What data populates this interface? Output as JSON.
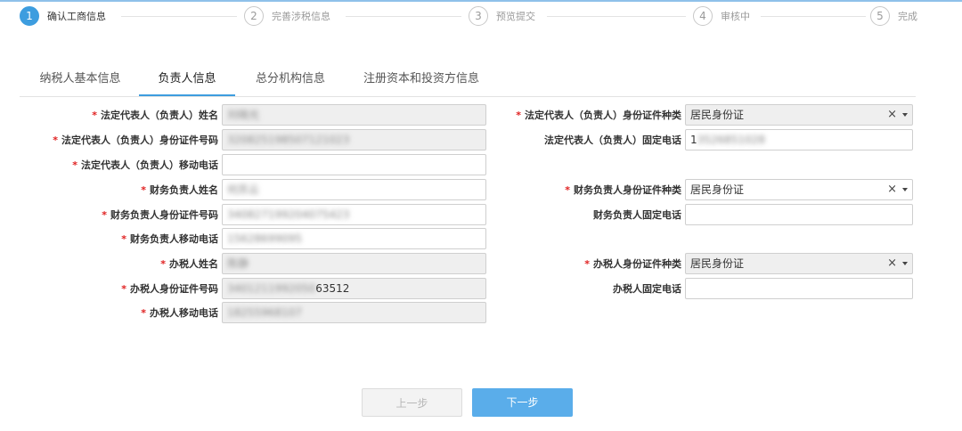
{
  "steps": [
    {
      "num": "1",
      "label": "确认工商信息",
      "active": true
    },
    {
      "num": "2",
      "label": "完善涉税信息",
      "active": false
    },
    {
      "num": "3",
      "label": "预览提交",
      "active": false
    },
    {
      "num": "4",
      "label": "审核中",
      "active": false
    },
    {
      "num": "5",
      "label": "完成",
      "active": false
    }
  ],
  "tabs": [
    {
      "label": "纳税人基本信息",
      "active": false
    },
    {
      "label": "负责人信息",
      "active": true
    },
    {
      "label": "总分机构信息",
      "active": false
    },
    {
      "label": "注册资本和投资方信息",
      "active": false
    }
  ],
  "form": {
    "legal_name": {
      "label": "法定代表人（负责人）姓名",
      "required": true,
      "value": "刘晓光",
      "readonly": true,
      "blurred": true
    },
    "legal_id_type": {
      "label": "法定代表人（负责人）身份证件种类",
      "required": true,
      "value": "居民身份证",
      "readonly": true
    },
    "legal_id_no": {
      "label": "法定代表人（负责人）身份证件号码",
      "required": true,
      "value": "320825198507121023",
      "readonly": true,
      "blurred": true
    },
    "legal_phone": {
      "label": "法定代表人（负责人）固定电话",
      "required": false,
      "value_prefix": "1",
      "value_blurred": "3526851028",
      "readonly": false
    },
    "legal_mobile": {
      "label": "法定代表人（负责人）移动电话",
      "required": true,
      "value": "",
      "readonly": false
    },
    "fin_name": {
      "label": "财务负责人姓名",
      "required": true,
      "value": "何苏云",
      "readonly": false,
      "blurred": true
    },
    "fin_id_type": {
      "label": "财务负责人身份证件种类",
      "required": true,
      "value": "居民身份证",
      "readonly": false
    },
    "fin_id_no": {
      "label": "财务负责人身份证件号码",
      "required": true,
      "value": "340827199204075423",
      "readonly": false,
      "blurred": true
    },
    "fin_phone": {
      "label": "财务负责人固定电话",
      "required": false,
      "value": "",
      "readonly": false
    },
    "fin_mobile": {
      "label": "财务负责人移动电话",
      "required": true,
      "value": "15628699095",
      "readonly": false,
      "blurred": true
    },
    "tax_name": {
      "label": "办税人姓名",
      "required": true,
      "value": "陈静",
      "readonly": true,
      "blurred": true
    },
    "tax_id_type": {
      "label": "办税人身份证件种类",
      "required": true,
      "value": "居民身份证",
      "readonly": true
    },
    "tax_id_no": {
      "label": "办税人身份证件号码",
      "required": true,
      "value_blurred": "3401211992050",
      "value_clear": "63512",
      "readonly": true
    },
    "tax_phone": {
      "label": "办税人固定电话",
      "required": false,
      "value": "",
      "readonly": false
    },
    "tax_mobile": {
      "label": "办税人移动电话",
      "required": true,
      "value": "18255968107",
      "readonly": true,
      "blurred": true
    }
  },
  "icons": {
    "clear": "clear-x-icon",
    "dropdown": "caret-down-icon"
  },
  "buttons": {
    "prev": "上一步",
    "next": "下一步"
  },
  "colors": {
    "accent": "#3d9ddf",
    "next_button": "#5aadea",
    "required": "#e02020",
    "readonly_bg": "#efefef"
  }
}
